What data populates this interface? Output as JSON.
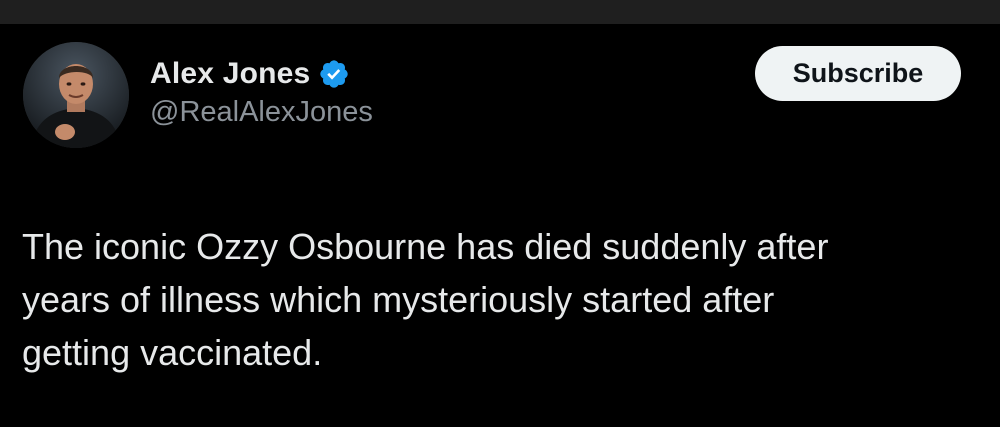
{
  "post": {
    "author": {
      "display_name": "Alex Jones",
      "handle": "@RealAlexJones",
      "verified": true,
      "avatar_icon": "profile-photo"
    },
    "subscribe_label": "Subscribe",
    "text": "The iconic Ozzy Osbourne has died suddenly after\nyears of illness which mysteriously started after\ngetting vaccinated."
  },
  "colors": {
    "background": "#000000",
    "text": "#e7e9ea",
    "secondary_text": "#8b9299",
    "verified_badge": "#1d9bf0",
    "button_bg": "#eff3f4",
    "button_text": "#0f1419"
  }
}
